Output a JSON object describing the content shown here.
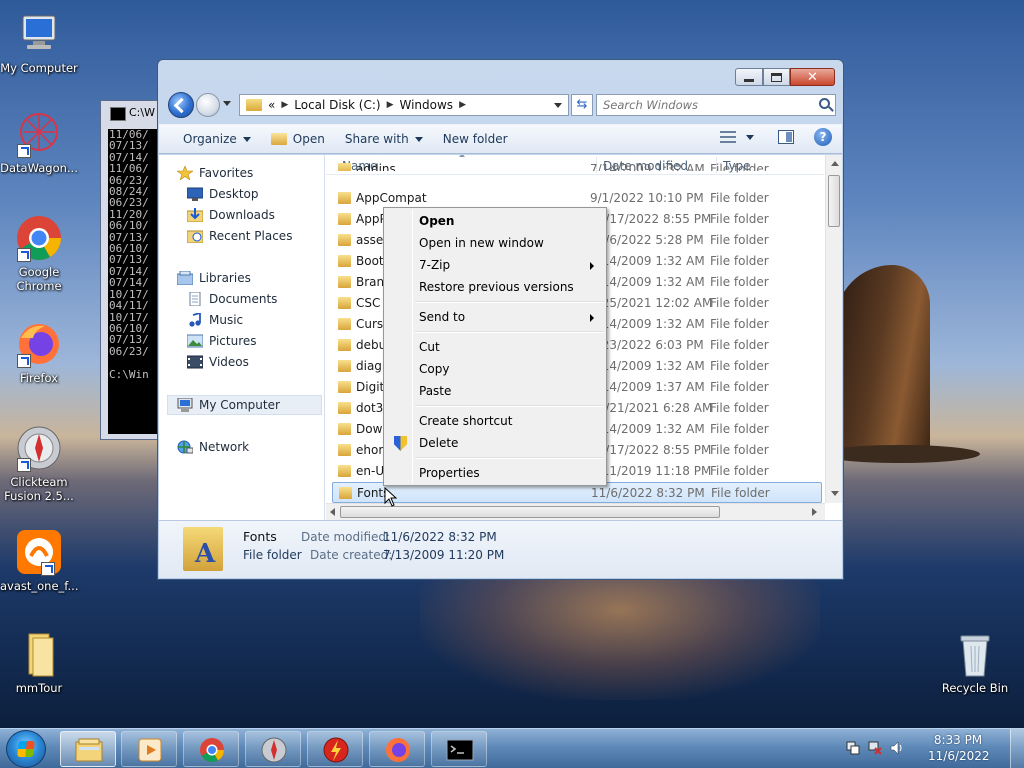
{
  "desktop": {
    "icons": [
      {
        "label": "My Computer",
        "icon": "computer-icon"
      },
      {
        "label": "DataWagon...",
        "icon": "datawagon-icon"
      },
      {
        "label": "Google Chrome",
        "icon": "chrome-icon"
      },
      {
        "label": "Firefox",
        "icon": "firefox-icon"
      },
      {
        "label": "Clickteam Fusion 2.5...",
        "icon": "clickteam-icon"
      },
      {
        "label": "avast_one_f...",
        "icon": "avast-icon"
      },
      {
        "label": "mmTour",
        "icon": "folder-icon"
      },
      {
        "label": "Recycle Bin",
        "icon": "recycle-bin-icon"
      }
    ]
  },
  "cmd": {
    "title": "C:\\W",
    "lines": [
      "11/06/",
      "07/13/",
      "07/14/",
      "11/06/",
      "06/23/",
      "08/24/",
      "06/23/",
      "11/20/",
      "06/10/",
      "07/13/",
      "06/10/",
      "07/13/",
      "07/14/",
      "07/14/",
      "10/17/",
      "04/11/",
      "10/17/",
      "06/10/",
      "07/13/",
      "06/23/"
    ],
    "prompt": "C:\\Win"
  },
  "explorer": {
    "address": {
      "root": "«",
      "crumbs": [
        "Local Disk (C:)",
        "Windows"
      ]
    },
    "search_placeholder": "Search Windows",
    "toolbar": {
      "organize": "Organize",
      "open": "Open",
      "share_with": "Share with",
      "new_folder": "New folder"
    },
    "nav": {
      "favorites": "Favorites",
      "fav_items": [
        "Desktop",
        "Downloads",
        "Recent Places"
      ],
      "libraries": "Libraries",
      "lib_items": [
        "Documents",
        "Music",
        "Pictures",
        "Videos"
      ],
      "my_computer": "My Computer",
      "network": "Network"
    },
    "columns": {
      "name": "Name",
      "date": "Date modified",
      "type": "Type"
    },
    "files": [
      {
        "name": "addins",
        "date": "7/14/2009 1:32 AM",
        "type": "File folder"
      },
      {
        "name": "AppCompat",
        "date": "9/1/2022 10:10 PM",
        "type": "File folder"
      },
      {
        "name": "AppPatch",
        "date": "10/17/2022 8:55 PM",
        "type": "File folder"
      },
      {
        "name": "assembly",
        "date": "11/6/2022 5:28 PM",
        "type": "File folder"
      },
      {
        "name": "Boot",
        "date": "7/14/2009 1:32 AM",
        "type": "File folder"
      },
      {
        "name": "Branding",
        "date": "7/14/2009 1:32 AM",
        "type": "File folder"
      },
      {
        "name": "CSC",
        "date": "6/25/2021 12:02 AM",
        "type": "File folder"
      },
      {
        "name": "Cursors",
        "date": "7/14/2009 1:32 AM",
        "type": "File folder"
      },
      {
        "name": "debug",
        "date": "6/23/2022 6:03 PM",
        "type": "File folder"
      },
      {
        "name": "diagnostics",
        "date": "7/14/2009 1:32 AM",
        "type": "File folder"
      },
      {
        "name": "DigitalLocker",
        "date": "7/14/2009 1:37 AM",
        "type": "File folder"
      },
      {
        "name": "dot3svc",
        "date": "12/21/2021 6:28 AM",
        "type": "File folder"
      },
      {
        "name": "Downloaded Program Files",
        "date": "7/14/2009 1:32 AM",
        "type": "File folder"
      },
      {
        "name": "ehome",
        "date": "10/17/2022 8:55 PM",
        "type": "File folder"
      },
      {
        "name": "en-US",
        "date": "4/11/2019 11:18 PM",
        "type": "File folder"
      },
      {
        "name": "Fonts",
        "date": "11/6/2022 8:32 PM",
        "type": "File folder"
      }
    ],
    "details": {
      "name": "Fonts",
      "kind": "File folder",
      "modified_label": "Date modified:",
      "modified": "11/6/2022 8:32 PM",
      "created_label": "Date created:",
      "created": "7/13/2009 11:20 PM"
    }
  },
  "context_menu": {
    "items": [
      "Open",
      "Open in new window",
      "7-Zip",
      "Restore previous versions",
      "Send to",
      "Cut",
      "Copy",
      "Paste",
      "Create shortcut",
      "Delete",
      "Properties"
    ]
  },
  "taskbar": {
    "apps": [
      "explorer-icon",
      "media-player-icon",
      "chrome-icon",
      "clickteam-icon",
      "flash-icon",
      "firefox-icon",
      "cmd-icon"
    ],
    "clock_time": "8:33 PM",
    "clock_date": "11/6/2022"
  }
}
